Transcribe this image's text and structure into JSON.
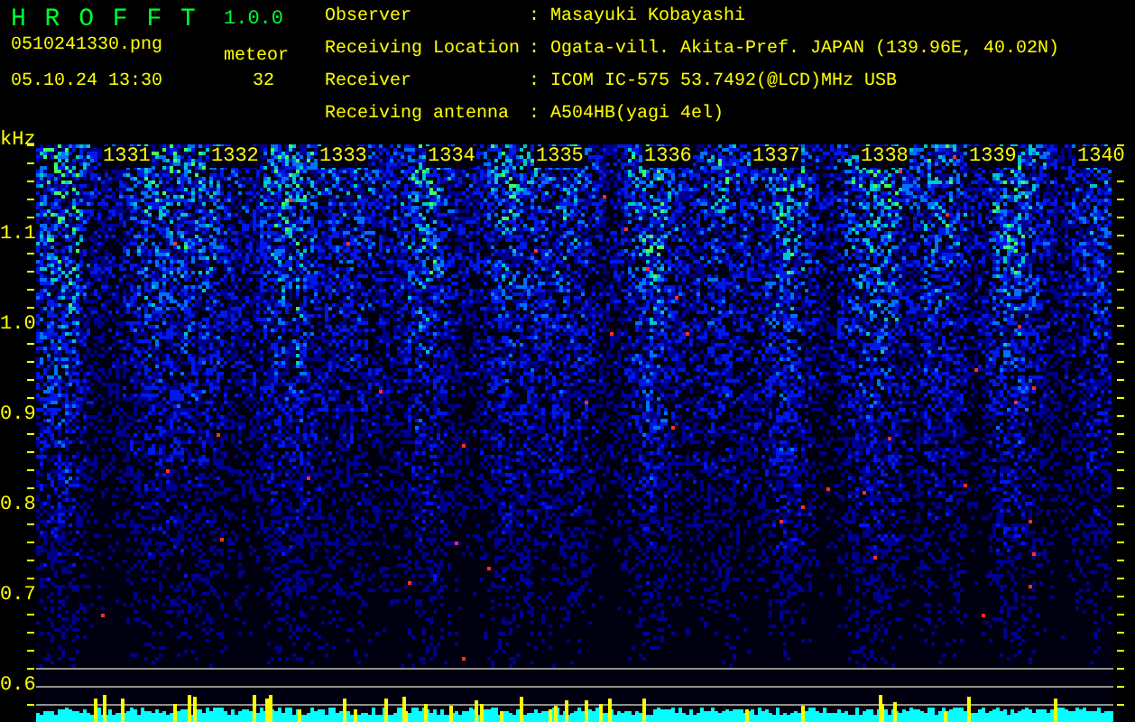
{
  "app": {
    "name": "H R O F F T",
    "version": "1.0.0",
    "filename": "0510241330.png",
    "datetime": "05.10.24 13:30",
    "meteor_label": "meteor",
    "meteor_count": "32"
  },
  "info": [
    {
      "label": "Observer",
      "separator": ":",
      "value": "Masayuki Kobayashi"
    },
    {
      "label": "Receiving Location",
      "separator": ":",
      "value": "Ogata-vill. Akita-Pref. JAPAN (139.96E, 40.02N)"
    },
    {
      "label": "Receiver",
      "separator": ":",
      "value": "ICOM IC-575 53.7492(@LCD)MHz USB"
    },
    {
      "label": "Receiving antenna",
      "separator": ":",
      "value": "A504HB(yagi 4el)"
    }
  ],
  "spectrogram": {
    "unit": "kHz",
    "yticks": [
      "1.1",
      "1.0",
      "0.9",
      "0.8",
      "0.7",
      "0.6"
    ],
    "time_labels": [
      "1331",
      "1332",
      "1333",
      "1334",
      "1335",
      "1336",
      "1337",
      "1338",
      "1339",
      "1340"
    ]
  }
}
